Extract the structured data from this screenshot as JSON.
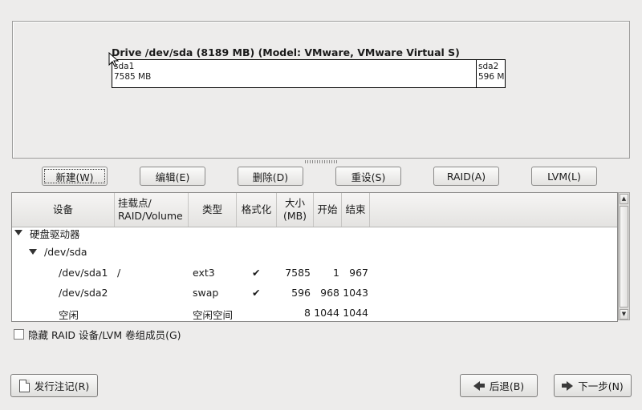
{
  "drive": {
    "title": "Drive /dev/sda (8189 MB) (Model: VMware, VMware Virtual S)",
    "segments": [
      {
        "name": "sda1",
        "size": "7585 MB",
        "mb": 7585
      },
      {
        "name": "sda2",
        "size": "596 M",
        "mb": 596
      }
    ]
  },
  "buttons": {
    "new": "新建(W)",
    "edit": "编辑(E)",
    "delete": "删除(D)",
    "reset": "重设(S)",
    "raid": "RAID(A)",
    "lvm": "LVM(L)"
  },
  "table": {
    "headers": {
      "device": "设备",
      "mount": "挂载点/ RAID/Volume",
      "type": "类型",
      "format": "格式化",
      "size": "大小 (MB)",
      "start": "开始",
      "end": "结束"
    },
    "group_label": "硬盘驱动器",
    "disk_label": "/dev/sda",
    "rows": [
      {
        "device": "/dev/sda1",
        "mount": "/",
        "type": "ext3",
        "format": "✔",
        "size": "7585",
        "start": "1",
        "end": "967"
      },
      {
        "device": "/dev/sda2",
        "mount": "",
        "type": "swap",
        "format": "✔",
        "size": "596",
        "start": "968",
        "end": "1043"
      },
      {
        "device": "空闲",
        "mount": "",
        "type": "空闲空间",
        "format": "",
        "size": "8",
        "start": "1044",
        "end": "1044"
      }
    ]
  },
  "hide_raid_lvm": {
    "label": "隐藏 RAID 设备/LVM 卷组成员(G)",
    "checked": false
  },
  "footer": {
    "release_notes": "发行注记(R)",
    "back": "后退(B)",
    "next": "下一步(N)"
  }
}
